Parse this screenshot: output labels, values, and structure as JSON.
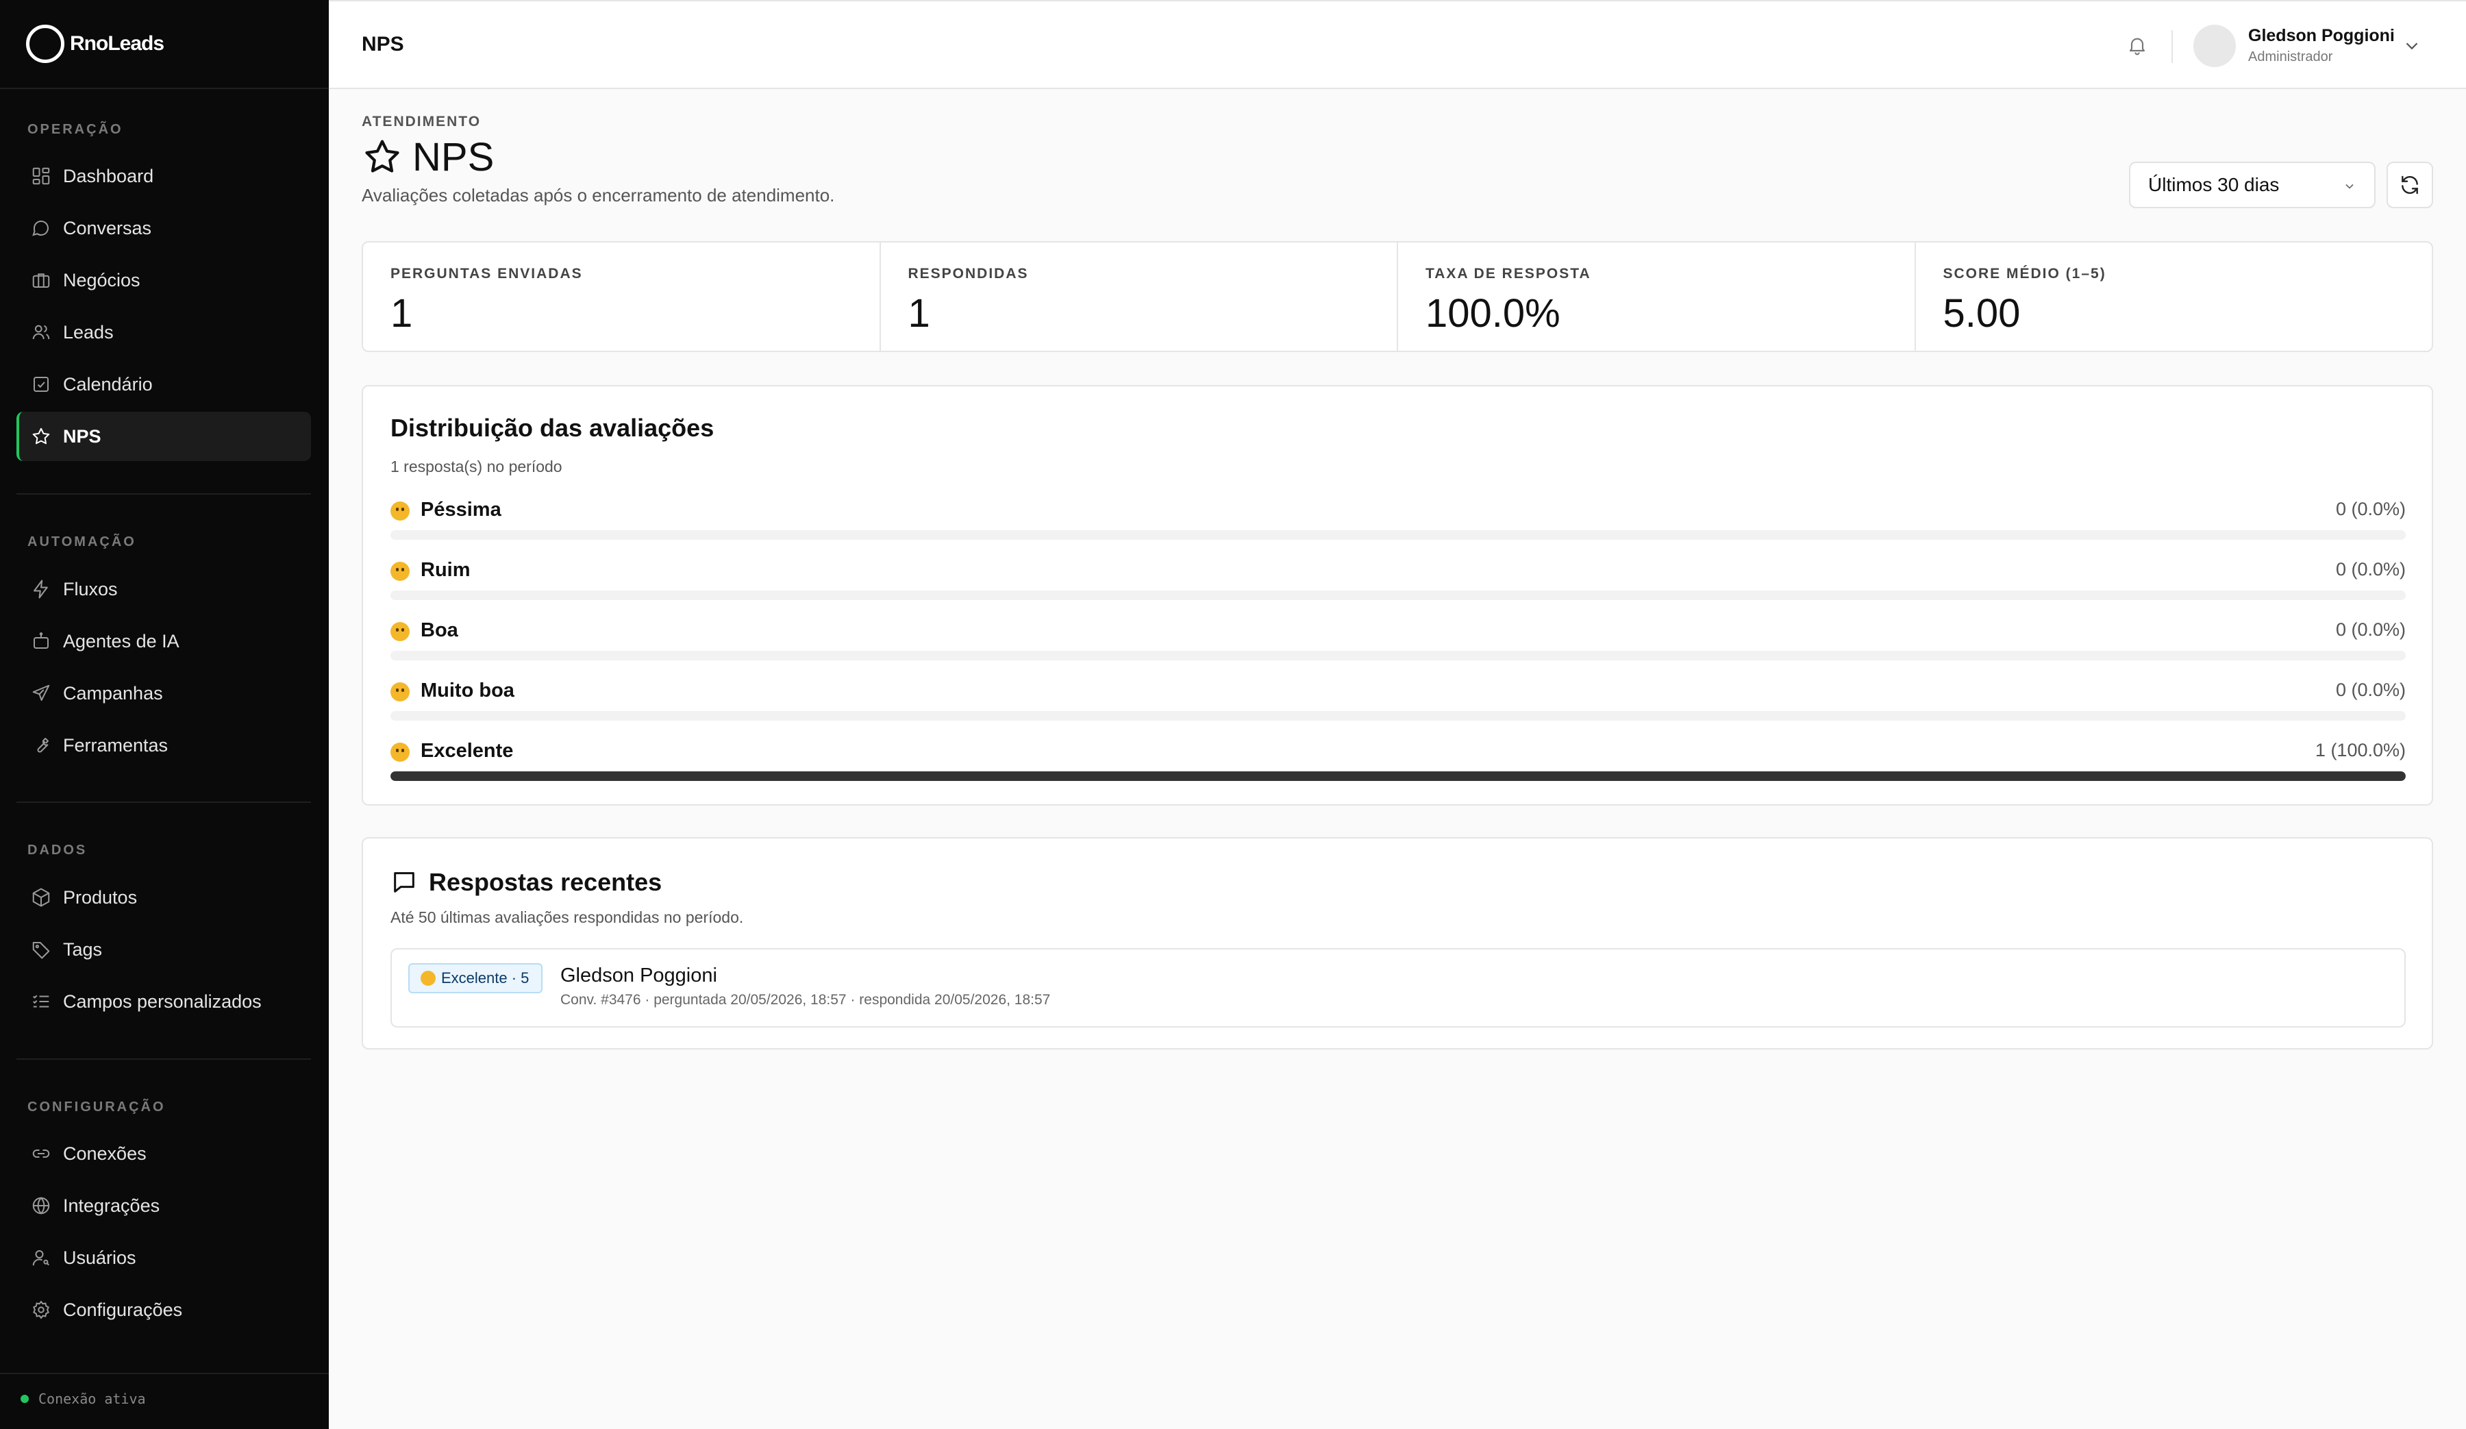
{
  "brand": {
    "name": "RnoLeads"
  },
  "sidebar": {
    "sections": [
      {
        "title": "OPERAÇÃO",
        "items": [
          {
            "label": "Dashboard",
            "icon": "dashboard-icon"
          },
          {
            "label": "Conversas",
            "icon": "chat-bubble-icon"
          },
          {
            "label": "Negócios",
            "icon": "briefcase-icon"
          },
          {
            "label": "Leads",
            "icon": "users-icon"
          },
          {
            "label": "Calendário",
            "icon": "calendar-check-icon"
          },
          {
            "label": "NPS",
            "icon": "star-icon",
            "active": true
          }
        ]
      },
      {
        "title": "AUTOMAÇÃO",
        "items": [
          {
            "label": "Fluxos",
            "icon": "lightning-icon"
          },
          {
            "label": "Agentes de IA",
            "icon": "robot-icon"
          },
          {
            "label": "Campanhas",
            "icon": "send-icon"
          },
          {
            "label": "Ferramentas",
            "icon": "wrench-icon"
          }
        ]
      },
      {
        "title": "DADOS",
        "items": [
          {
            "label": "Produtos",
            "icon": "box-icon"
          },
          {
            "label": "Tags",
            "icon": "tag-icon"
          },
          {
            "label": "Campos personalizados",
            "icon": "list-check-icon"
          }
        ]
      },
      {
        "title": "CONFIGURAÇÃO",
        "items": [
          {
            "label": "Conexões",
            "icon": "link-icon"
          },
          {
            "label": "Integrações",
            "icon": "globe-icon"
          },
          {
            "label": "Usuários",
            "icon": "user-key-icon"
          },
          {
            "label": "Configurações",
            "icon": "gear-icon"
          }
        ]
      }
    ],
    "connection_status": "Conexão ativa",
    "active_accent": "#22c55e"
  },
  "topbar": {
    "title": "NPS",
    "user": {
      "name": "Gledson Poggioni",
      "role": "Administrador"
    }
  },
  "page": {
    "overline": "ATENDIMENTO",
    "title": "NPS",
    "subtitle": "Avaliações coletadas após o encerramento de atendimento.",
    "period_select": {
      "value": "Últimos 30 dias"
    }
  },
  "stats": [
    {
      "label": "PERGUNTAS ENVIADAS",
      "value": "1"
    },
    {
      "label": "RESPONDIDAS",
      "value": "1"
    },
    {
      "label": "TAXA DE RESPOSTA",
      "value": "100.0%"
    },
    {
      "label": "SCORE MÉDIO (1–5)",
      "value": "5.00"
    }
  ],
  "distribution": {
    "title": "Distribuição das avaliações",
    "subtitle": "1 resposta(s) no período",
    "rows": [
      {
        "label": "Péssima",
        "value": "0 (0.0%)",
        "fraction": 0
      },
      {
        "label": "Ruim",
        "value": "0 (0.0%)",
        "fraction": 0
      },
      {
        "label": "Boa",
        "value": "0 (0.0%)",
        "fraction": 0
      },
      {
        "label": "Muito boa",
        "value": "0 (0.0%)",
        "fraction": 0
      },
      {
        "label": "Excelente",
        "value": "1 (100.0%)",
        "fraction": 1
      }
    ]
  },
  "recent": {
    "title": "Respostas recentes",
    "subtitle": "Até 50 últimas avaliações respondidas no período.",
    "items": [
      {
        "badge": "Excelente · 5",
        "name": "Gledson Poggioni",
        "meta": "Conv. #3476 · perguntada 20/05/2026, 18:57 · respondida 20/05/2026, 18:57"
      }
    ]
  }
}
